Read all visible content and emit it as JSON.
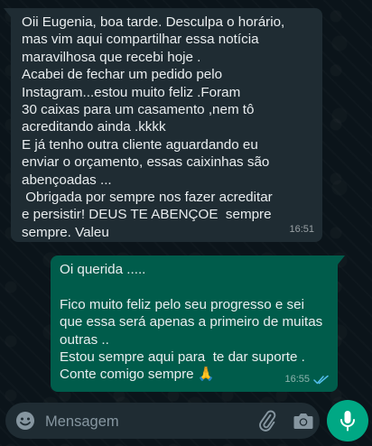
{
  "incoming": {
    "lines": [
      "Oii Eugenia, boa tarde. Desculpa o horário,",
      "mas vim aqui compartilhar essa notícia",
      "maravilhosa que recebi hoje .",
      "Acabei de fechar um pedido pelo",
      "Instagram...estou muito feliz .Foram",
      "30 caixas para um casamento ,nem tô",
      "acreditando ainda .kkkk",
      "E já tenho outra cliente aguardando eu",
      "enviar o orçamento, essas caixinhas são",
      "abençoadas ...",
      " Obrigada por sempre nos fazer acreditar",
      "e persistir! DEUS TE ABENÇOE  sempre",
      "sempre. Valeu"
    ],
    "time": "16:51"
  },
  "outgoing": {
    "lines": [
      "Oi querida .....",
      "",
      "Fico muito feliz pelo seu progresso e sei",
      "que essa será apenas a primeiro de muitas",
      "outras ..",
      "Estou sempre aqui para  te dar suporte .",
      "Conte comigo sempre 🙏"
    ],
    "time": "16:55",
    "status": "read"
  },
  "composer": {
    "placeholder": "Mensagem",
    "icons": [
      "emoji-icon",
      "attach-icon",
      "camera-icon",
      "mic-icon"
    ]
  },
  "colors": {
    "background": "#0b141a",
    "incoming_bubble": "#1f2c33",
    "outgoing_bubble": "#005c4b",
    "accent": "#00a884",
    "read_ticks": "#53bdeb"
  }
}
